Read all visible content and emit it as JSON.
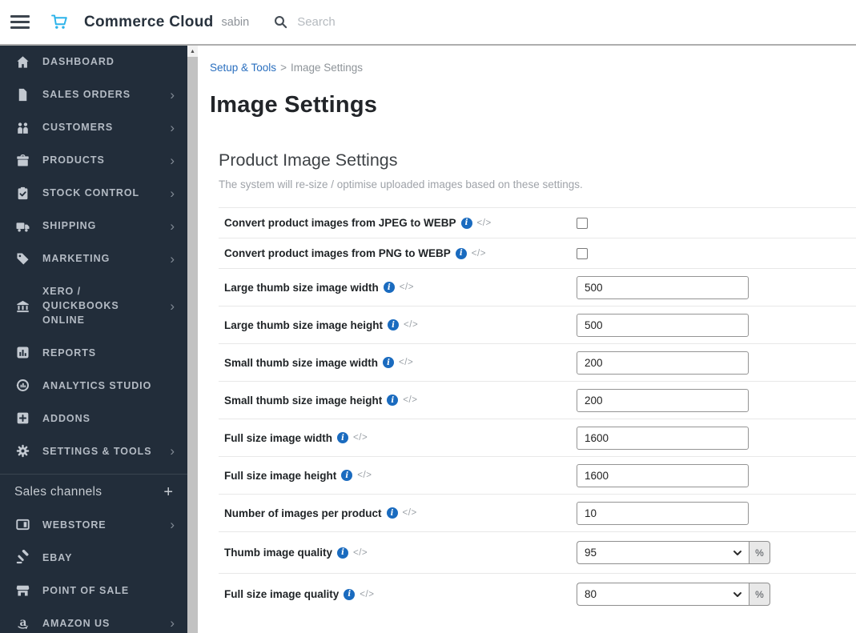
{
  "colors": {
    "sidebar_bg": "#222d3a",
    "accent_blue": "#2cb3ea",
    "link_blue": "#2a6fbf",
    "info_blue": "#1a6bbf"
  },
  "header": {
    "brand": "Commerce Cloud",
    "user": "sabin",
    "search_placeholder": "Search"
  },
  "sidebar": {
    "items": [
      {
        "label": "DASHBOARD",
        "icon": "home",
        "chevron": false
      },
      {
        "label": "SALES ORDERS",
        "icon": "file",
        "chevron": true
      },
      {
        "label": "CUSTOMERS",
        "icon": "people",
        "chevron": true
      },
      {
        "label": "PRODUCTS",
        "icon": "box",
        "chevron": true
      },
      {
        "label": "STOCK CONTROL",
        "icon": "clipboard-check",
        "chevron": true
      },
      {
        "label": "SHIPPING",
        "icon": "truck",
        "chevron": true
      },
      {
        "label": "MARKETING",
        "icon": "tag",
        "chevron": true
      },
      {
        "label": "XERO / QUICKBOOKS ONLINE",
        "icon": "bank",
        "chevron": true
      },
      {
        "label": "REPORTS",
        "icon": "bar-chart",
        "chevron": false
      },
      {
        "label": "ANALYTICS STUDIO",
        "icon": "analytics",
        "chevron": false
      },
      {
        "label": "ADDONS",
        "icon": "plus-square",
        "chevron": false
      },
      {
        "label": "SETTINGS & TOOLS",
        "icon": "gear",
        "chevron": true
      }
    ],
    "sales_channels": {
      "title": "Sales channels",
      "add_label": "+",
      "items": [
        {
          "label": "WEBSTORE",
          "icon": "browser",
          "chevron": true
        },
        {
          "label": "EBAY",
          "icon": "gavel",
          "chevron": false
        },
        {
          "label": "POINT OF SALE",
          "icon": "store",
          "chevron": false
        },
        {
          "label": "AMAZON US",
          "icon": "amazon",
          "chevron": true
        }
      ]
    }
  },
  "breadcrumb": {
    "link": "Setup & Tools",
    "separator": ">",
    "current": "Image Settings"
  },
  "page_title": "Image Settings",
  "section": {
    "title": "Product Image Settings",
    "description": "The system will re-size / optimise uploaded images based on these settings."
  },
  "form": {
    "code_icon": "</>",
    "info_icon": "i",
    "rows": [
      {
        "label": "Convert product images from JPEG to WEBP",
        "control": "checkbox",
        "checked": false
      },
      {
        "label": "Convert product images from PNG to WEBP",
        "control": "checkbox",
        "checked": false
      },
      {
        "label": "Large thumb size image width",
        "control": "input",
        "value": "500"
      },
      {
        "label": "Large thumb size image height",
        "control": "input",
        "value": "500"
      },
      {
        "label": "Small thumb size image width",
        "control": "input",
        "value": "200"
      },
      {
        "label": "Small thumb size image height",
        "control": "input",
        "value": "200"
      },
      {
        "label": "Full size image width",
        "control": "input",
        "value": "1600"
      },
      {
        "label": "Full size image height",
        "control": "input",
        "value": "1600"
      },
      {
        "label": "Number of images per product",
        "control": "input",
        "value": "10"
      },
      {
        "label": "Thumb image quality",
        "control": "select",
        "value": "95",
        "unit": "%"
      },
      {
        "label": "Full size image quality",
        "control": "select",
        "value": "80",
        "unit": "%"
      }
    ]
  }
}
